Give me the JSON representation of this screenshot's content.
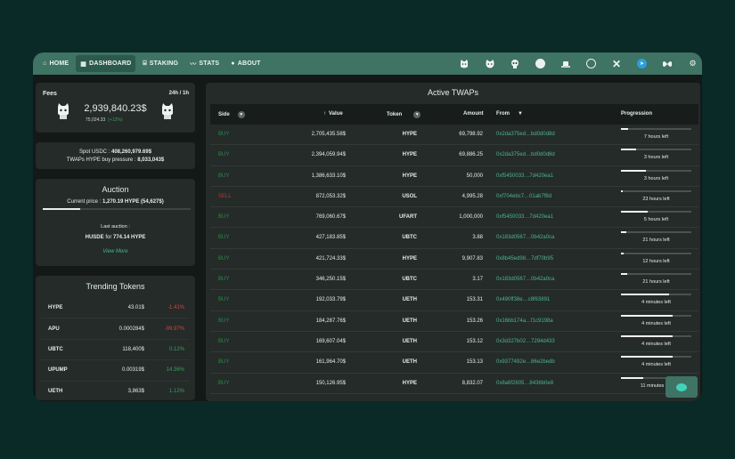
{
  "nav": {
    "items": [
      {
        "label": "HOME",
        "icon": "home-icon",
        "glyph": "⌂"
      },
      {
        "label": "DASHBOARD",
        "icon": "grid-icon",
        "glyph": "▦"
      },
      {
        "label": "STAKING",
        "icon": "bank-icon",
        "glyph": "⌸"
      },
      {
        "label": "STATS",
        "icon": "chart-line-icon",
        "glyph": "〰"
      },
      {
        "label": "ABOUT",
        "icon": "info-icon",
        "glyph": "●"
      }
    ],
    "active": "DASHBOARD"
  },
  "fees": {
    "title": "Fees",
    "range": "24h / 1h",
    "total": "2,939,840.23$",
    "recent": "75,024.33",
    "recent_change": "(+12%)"
  },
  "spot": {
    "usdc_label": "Spot USDC : ",
    "usdc_value": "408,260,979.69$",
    "pressure_label": "TWAPs HYPE buy pressure : ",
    "pressure_value": "8,033,043$"
  },
  "auction": {
    "title": "Auction",
    "current_label": "Current price : ",
    "current_value": "1,270.19 HYPE (54,627$)",
    "progress": 0.25,
    "last_label": "Last auction :",
    "last_token": "HUSDE",
    "last_for": " for ",
    "last_value": "774.14 HYPE",
    "view_more": "View More"
  },
  "trending": {
    "title": "Trending Tokens",
    "rows": [
      {
        "name": "HYPE",
        "price": "43.01$",
        "change": "-1.41%",
        "dir": "neg"
      },
      {
        "name": "APU",
        "price": "0.000284$",
        "change": "-99.97%",
        "dir": "neg"
      },
      {
        "name": "UBTC",
        "price": "118,400$",
        "change": "0.12%",
        "dir": "pos"
      },
      {
        "name": "UPUMP",
        "price": "0.00319$",
        "change": "14.36%",
        "dir": "pos"
      },
      {
        "name": "UETH",
        "price": "3,863$",
        "change": "1.12%",
        "dir": "pos"
      }
    ]
  },
  "twaps": {
    "title": "Active TWAPs",
    "columns": {
      "side": "Side",
      "value": "Value",
      "token": "Token",
      "amount": "Amount",
      "from": "From",
      "progression": "Progression"
    },
    "rows": [
      {
        "side": "BUY",
        "value": "2,705,435.58$",
        "token": "HYPE",
        "amount": "69,798.92",
        "from": "0x2da375ed…bd0d0d8d",
        "progress": 0.1,
        "left": "7 hours left"
      },
      {
        "side": "BUY",
        "value": "2,394,059.94$",
        "token": "HYPE",
        "amount": "69,886.25",
        "from": "0x2da375ed…bd0d0d8d",
        "progress": 0.22,
        "left": "3 hours left"
      },
      {
        "side": "BUY",
        "value": "1,386,633.10$",
        "token": "HYPE",
        "amount": "50,000",
        "from": "0xf5450033…7d420ea1",
        "progress": 0.35,
        "left": "3 hours left"
      },
      {
        "side": "SELL",
        "value": "872,053.32$",
        "token": "USOL",
        "amount": "4,995.28",
        "from": "0xf704ebc7…01ab7f8d",
        "progress": 0.02,
        "left": "23 hours left"
      },
      {
        "side": "BUY",
        "value": "769,060.67$",
        "token": "UFART",
        "amount": "1,000,000",
        "from": "0xf5450033…7d420ea1",
        "progress": 0.38,
        "left": "5 hours left"
      },
      {
        "side": "BUY",
        "value": "427,183.85$",
        "token": "UBTC",
        "amount": "3.88",
        "from": "0x183d0567…0b42a0ca",
        "progress": 0.07,
        "left": "21 hours left"
      },
      {
        "side": "BUY",
        "value": "421,724.33$",
        "token": "HYPE",
        "amount": "9,907.83",
        "from": "0x8b45ed98…7df70b95",
        "progress": 0.04,
        "left": "12 hours left"
      },
      {
        "side": "BUY",
        "value": "346,250.15$",
        "token": "UBTC",
        "amount": "3.17",
        "from": "0x183d0567…0b42a0ca",
        "progress": 0.09,
        "left": "21 hours left"
      },
      {
        "side": "BUY",
        "value": "192,033.79$",
        "token": "UETH",
        "amount": "153.31",
        "from": "0x490ff38e…c8f63891",
        "progress": 0.68,
        "left": "4 minutes left"
      },
      {
        "side": "BUY",
        "value": "184,287.76$",
        "token": "UETH",
        "amount": "153.26",
        "from": "0x16bb174a…f1c9198a",
        "progress": 0.74,
        "left": "4 minutes left"
      },
      {
        "side": "BUY",
        "value": "169,607.04$",
        "token": "UETH",
        "amount": "153.12",
        "from": "0x3d327b02…7294d433",
        "progress": 0.74,
        "left": "4 minutes left"
      },
      {
        "side": "BUY",
        "value": "161,964.70$",
        "token": "UETH",
        "amount": "153.13",
        "from": "0x9377492e…86e2bedb",
        "progress": 0.74,
        "left": "4 minutes left"
      },
      {
        "side": "BUY",
        "value": "150,126.95$",
        "token": "HYPE",
        "amount": "8,832.07",
        "from": "0x8a6f2605…8436b0e8",
        "progress": 0.32,
        "left": "11 minutes left"
      }
    ]
  },
  "colors": {
    "accent": "#3f7364",
    "buy": "#2e8a4a",
    "sell": "#c8332f",
    "address": "#4fb38a"
  }
}
